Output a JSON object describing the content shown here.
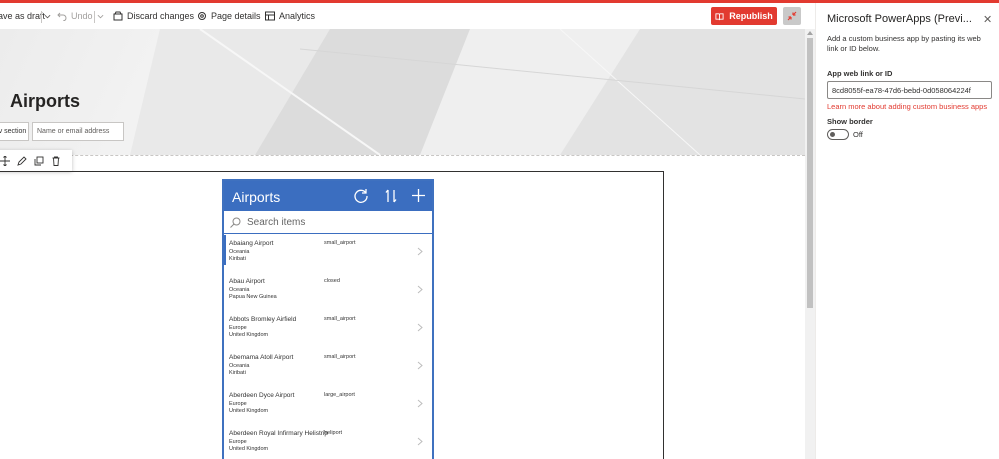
{
  "commandbar": {
    "save_draft": "ave as draft",
    "undo": "Undo",
    "discard": "Discard changes",
    "page_details": "Page details",
    "analytics": "Analytics",
    "republish": "Republish"
  },
  "hero": {
    "title": "Airports",
    "section_button": "v section",
    "name_placeholder": "Name or email address"
  },
  "app": {
    "title": "Airports",
    "search_placeholder": "Search items",
    "items": [
      {
        "name": "Abaiang Airport",
        "continent": "Oceania",
        "country": "Kiribati",
        "type": "small_airport"
      },
      {
        "name": "Abau Airport",
        "continent": "Oceania",
        "country": "Papua New Guinea",
        "type": "closed"
      },
      {
        "name": "Abbots Bromley Airfield",
        "continent": "Europe",
        "country": "United Kingdom",
        "type": "small_airport"
      },
      {
        "name": "Abemama Atoll Airport",
        "continent": "Oceania",
        "country": "Kiribati",
        "type": "small_airport"
      },
      {
        "name": "Aberdeen Dyce Airport",
        "continent": "Europe",
        "country": "United Kingdom",
        "type": "large_airport"
      },
      {
        "name": "Aberdeen Royal Infirmary Helistrip",
        "continent": "Europe",
        "country": "United Kingdom",
        "type": "heliport"
      }
    ]
  },
  "panel": {
    "title": "Microsoft PowerApps (Previ...",
    "description": "Add a custom business app by pasting its web link or ID below.",
    "link_label": "App web link or ID",
    "link_value": "8cd8055f-ea78-47d6-bebd-0d058064224f",
    "learn_more": "Learn more about adding custom business apps",
    "border_label": "Show border",
    "border_state": "Off"
  },
  "colors": {
    "accent": "#e23a30",
    "app_blue": "#3b6ec0"
  }
}
